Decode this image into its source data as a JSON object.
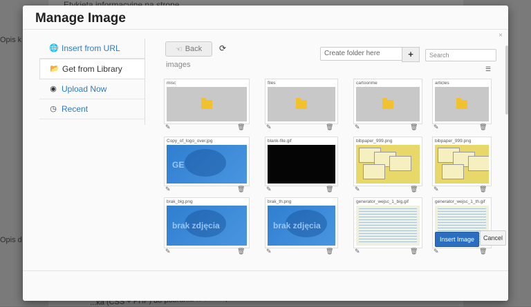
{
  "background": {
    "top_text": "Etykieta informacyjne na stronę",
    "label_1": "Opis k",
    "label_2": "Opis d",
    "bottom_text": "...ka (CSS + PHP) do pobrania w dziale pliki. Demo prezentuje dostępne rodzaje komunikatów."
  },
  "modal": {
    "title": "Manage Image",
    "close": "×"
  },
  "nav": {
    "items": [
      {
        "label": "Insert from URL",
        "icon": "globe-icon"
      },
      {
        "label": "Get from Library",
        "icon": "folder-open-icon"
      },
      {
        "label": "Upload Now",
        "icon": "eye-icon"
      },
      {
        "label": "Recent",
        "icon": "clock-icon"
      }
    ],
    "active_index": 1
  },
  "toolbar": {
    "back_label": "Back",
    "breadcrumb": "images",
    "folder_placeholder": "Create folder here",
    "add_label": "+",
    "search_placeholder": "Search"
  },
  "tiles": [
    {
      "name": "misc",
      "type": "folder"
    },
    {
      "name": "files",
      "type": "folder"
    },
    {
      "name": "cartoonme",
      "type": "folder"
    },
    {
      "name": "articles",
      "type": "folder"
    },
    {
      "name": "Copy_of_logo_over.jpg",
      "type": "blue-logo"
    },
    {
      "name": "blank-file.gif",
      "type": "dark"
    },
    {
      "name": "bibpaper_999.png",
      "type": "yellow"
    },
    {
      "name": "bibpaper_999.png",
      "type": "yellow"
    },
    {
      "name": "brak_big.png",
      "type": "brak"
    },
    {
      "name": "brak_th.png",
      "type": "brak"
    },
    {
      "name": "generator_wejsc_1_big.gif",
      "type": "doc"
    },
    {
      "name": "generator_wejsc_1_th.gif",
      "type": "doc"
    }
  ],
  "thumb_texts": {
    "brak": "brak zdjęcia",
    "logo": "GE"
  },
  "footer": {
    "insert_label": "Insert Image",
    "cancel_label": "Cancel"
  }
}
